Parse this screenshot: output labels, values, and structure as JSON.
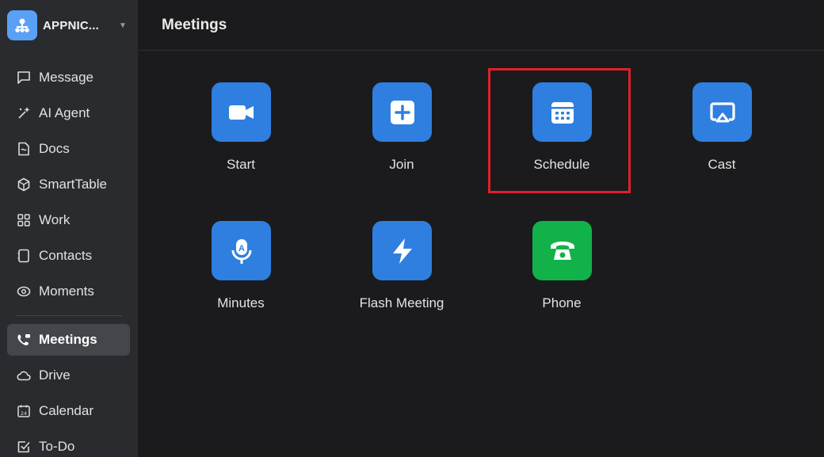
{
  "org": {
    "name": "APPNIC...",
    "logo_icon": "org-people-icon"
  },
  "nav": {
    "items": [
      {
        "label": "Message",
        "icon": "message-icon"
      },
      {
        "label": "AI Agent",
        "icon": "ai-sparkle-icon"
      },
      {
        "label": "Docs",
        "icon": "docs-icon"
      },
      {
        "label": "SmartTable",
        "icon": "smarttable-icon"
      },
      {
        "label": "Work",
        "icon": "grid-icon"
      },
      {
        "label": "Contacts",
        "icon": "contacts-icon"
      },
      {
        "label": "Moments",
        "icon": "moments-icon"
      },
      {
        "label": "Meetings",
        "icon": "meetings-icon",
        "active": true
      },
      {
        "label": "Drive",
        "icon": "cloud-icon"
      },
      {
        "label": "Calendar",
        "icon": "calendar-icon"
      },
      {
        "label": "To-Do",
        "icon": "checkbox-icon"
      }
    ]
  },
  "header": {
    "title": "Meetings"
  },
  "tiles": [
    {
      "label": "Start",
      "icon": "video-camera-icon",
      "color": "#2f7fe0"
    },
    {
      "label": "Join",
      "icon": "plus-icon",
      "color": "#2f7fe0"
    },
    {
      "label": "Schedule",
      "icon": "calendar-grid-icon",
      "color": "#2f7fe0",
      "highlighted": true
    },
    {
      "label": "Cast",
      "icon": "cast-screen-icon",
      "color": "#2f7fe0"
    },
    {
      "label": "Minutes",
      "icon": "microphone-ai-icon",
      "color": "#2f7fe0"
    },
    {
      "label": "Flash Meeting",
      "icon": "lightning-icon",
      "color": "#2f7fe0"
    },
    {
      "label": "Phone",
      "icon": "phone-icon",
      "color": "#12b24a"
    }
  ],
  "colors": {
    "accent": "#2f7fe0",
    "phone_green": "#12b24a",
    "highlight_red": "#e0202a"
  }
}
